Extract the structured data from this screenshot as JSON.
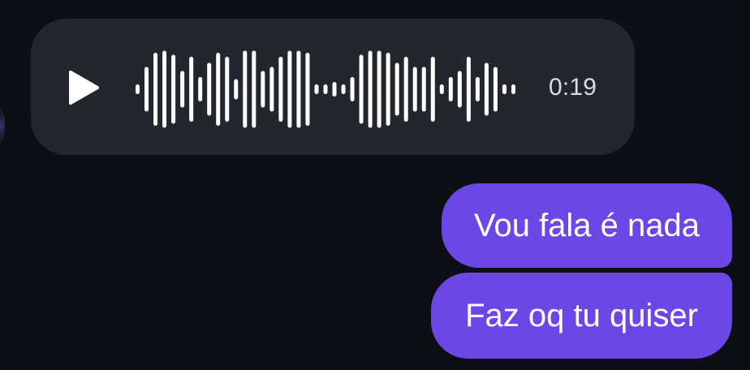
{
  "conversation": {
    "incoming_voice": {
      "duration": "0:19",
      "play_icon": "play-icon",
      "waveform_levels": [
        0.12,
        0.55,
        0.9,
        0.95,
        0.85,
        0.45,
        0.8,
        0.3,
        0.65,
        0.9,
        0.8,
        0.25,
        0.95,
        0.95,
        0.45,
        0.55,
        0.8,
        0.95,
        0.95,
        0.9,
        0.12,
        0.12,
        0.18,
        0.12,
        0.3,
        0.85,
        0.95,
        0.95,
        0.9,
        0.65,
        0.8,
        0.55,
        0.55,
        0.8,
        0.12,
        0.3,
        0.45,
        0.8,
        0.3,
        0.65,
        0.55,
        0.12,
        0.12
      ]
    },
    "outgoing_messages": [
      {
        "text": "Vou fala é nada"
      },
      {
        "text": "Faz oq tu quiser"
      }
    ]
  },
  "colors": {
    "background": "#0c0f14",
    "incoming_bubble": "#23272d",
    "outgoing_bubble": "#6c47e8",
    "waveform": "#ffffff",
    "duration_text": "#d9dbe0"
  }
}
